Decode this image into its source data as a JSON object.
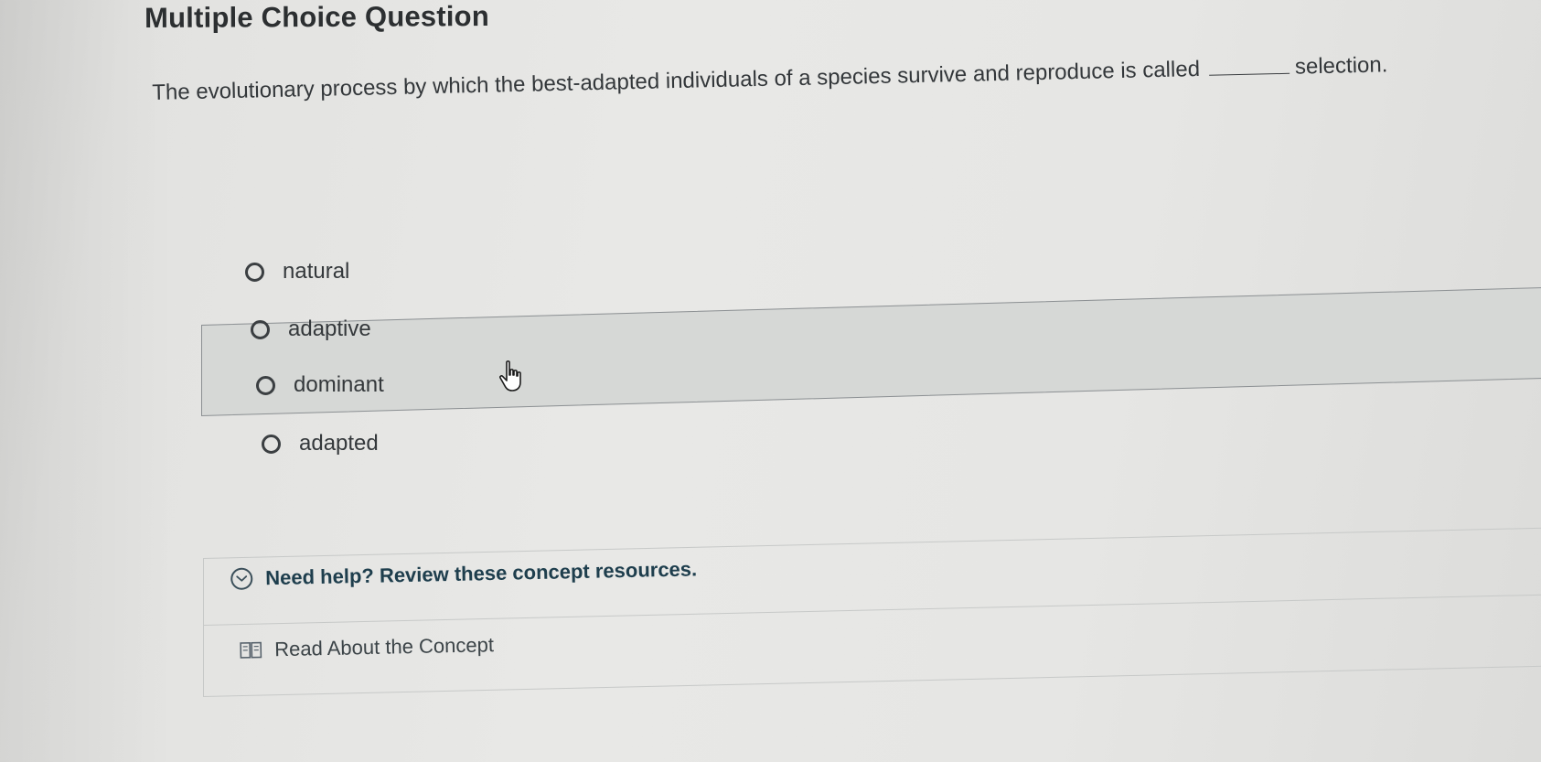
{
  "page": {
    "title": "Multiple Choice Question"
  },
  "question": {
    "text_before_blank": "The evolutionary process by which the best-adapted individuals of a species survive and reproduce is called",
    "text_after_blank": "selection."
  },
  "options": [
    {
      "label": "natural",
      "selected": false
    },
    {
      "label": "adaptive",
      "selected": false
    },
    {
      "label": "dominant",
      "selected": false,
      "hovered": true
    },
    {
      "label": "adapted",
      "selected": false
    }
  ],
  "help": {
    "toggle_label": "Need help? Review these concept resources.",
    "resources": [
      {
        "label": "Read About the Concept",
        "icon": "book-icon"
      }
    ]
  },
  "icons": {
    "cursor": "hand-pointer-icon",
    "toggle": "chevron-down-circle-icon"
  },
  "colors": {
    "help_text": "#1e3e4d",
    "hover_row": "#d6d8d6"
  }
}
